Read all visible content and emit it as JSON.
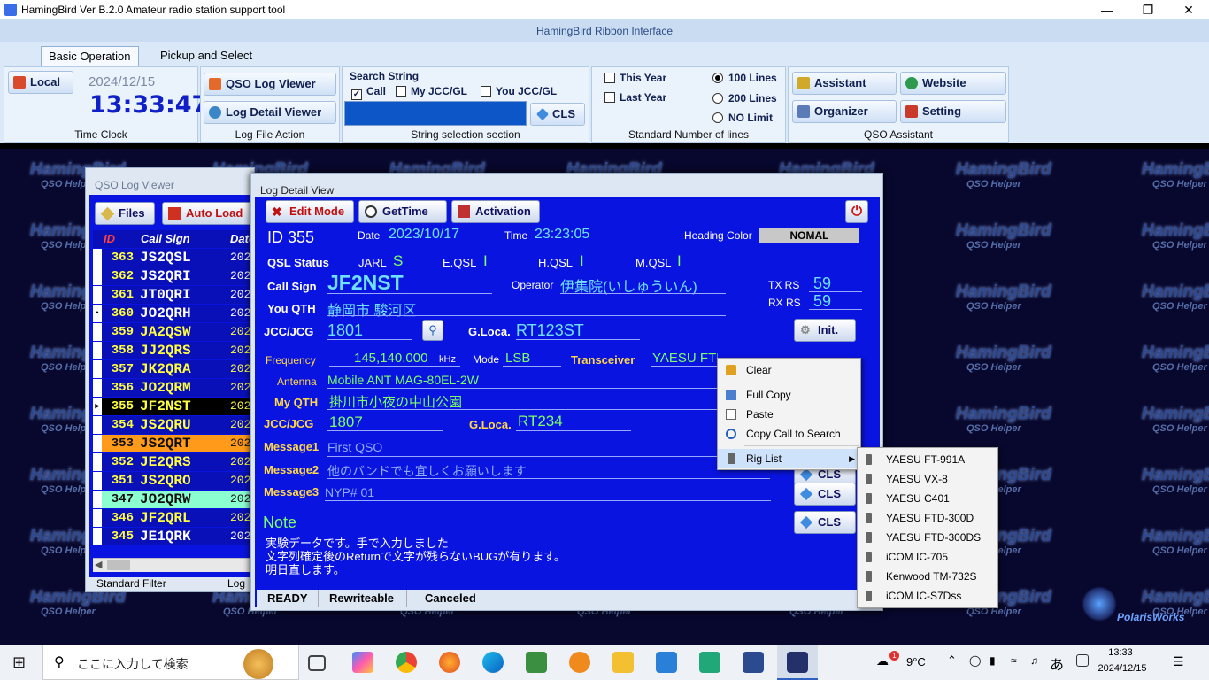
{
  "window": {
    "title": "HamingBird Ver B.2.0   Amateur radio station support tool"
  },
  "ribbon": {
    "header": "HamingBird Ribbon Interface",
    "tabs": [
      "Basic Operation",
      "Pickup and Select"
    ],
    "time_clock": {
      "local_label": "Local",
      "date": "2024/12/15",
      "time": "13:33:47",
      "group_label": "Time Clock"
    },
    "log_file_action": {
      "qso_log_viewer": "QSO Log Viewer",
      "log_detail_viewer": "Log Detail Viewer",
      "group_label": "Log File Action"
    },
    "string_selection": {
      "search_label": "Search String",
      "call": "Call",
      "my_jcc": "My JCC/GL",
      "you_jcc": "You JCC/GL",
      "cls": "CLS",
      "group_label": "String selection section"
    },
    "lines": {
      "this_year": "This Year",
      "last_year": "Last Year",
      "opt100": "100 Lines",
      "opt200": "200 Lines",
      "optno": "NO Limit",
      "group_label": "Standard Number of lines"
    },
    "assistant": {
      "assistant": "Assistant",
      "website": "Website",
      "organizer": "Organizer",
      "setting": "Setting",
      "group_label": "QSO Assistant"
    }
  },
  "watermark": {
    "brand": "HamingBird",
    "sub": "QSO Helper",
    "corner": "PolarisWorks"
  },
  "qso_viewer": {
    "title": "QSO Log Viewer",
    "files": "Files",
    "auto_load": "Auto Load",
    "col_id": "ID",
    "col_call": "Call Sign",
    "col_date": "Date",
    "footer_left": "Standard Filter",
    "footer_right": "Log",
    "rows": [
      {
        "id": "363",
        "call": "JS2QSL",
        "date": "202",
        "bg": "#0a10b8",
        "fg": "#ffffff",
        "idbg": "#0a10b8",
        "idfg": "#ffff40"
      },
      {
        "id": "362",
        "call": "JS2QRI",
        "date": "202",
        "bg": "#0a10b8",
        "fg": "#ffffff",
        "idbg": "#0a10b8",
        "idfg": "#ffff40"
      },
      {
        "id": "361",
        "call": "JT0QRI",
        "date": "202",
        "bg": "#0a10b8",
        "fg": "#ffffff",
        "idbg": "#0a10b8",
        "idfg": "#ffff40"
      },
      {
        "id": "360",
        "call": "JO2QRH",
        "date": "202",
        "bg": "#0a10b8",
        "fg": "#ffffff",
        "idbg": "#0a10b8",
        "idfg": "#ffff40"
      },
      {
        "id": "359",
        "call": "JA2QSW",
        "date": "202",
        "bg": "#0a10b8",
        "fg": "#ffff40",
        "idbg": "#0a10b8",
        "idfg": "#ffff40"
      },
      {
        "id": "358",
        "call": "JJ2QRS",
        "date": "202",
        "bg": "#0a10b8",
        "fg": "#ffff40",
        "idbg": "#0a10b8",
        "idfg": "#ffff40"
      },
      {
        "id": "357",
        "call": "JK2QRA",
        "date": "202",
        "bg": "#0a10b8",
        "fg": "#ffff40",
        "idbg": "#0a10b8",
        "idfg": "#ffff40"
      },
      {
        "id": "356",
        "call": "JO2QRM",
        "date": "202",
        "bg": "#0a10b8",
        "fg": "#ffff40",
        "idbg": "#0a10b8",
        "idfg": "#ffff40"
      },
      {
        "id": "355",
        "call": "JF2NST",
        "date": "202",
        "bg": "#000000",
        "fg": "#ffff40",
        "idbg": "#000000",
        "idfg": "#ffff40"
      },
      {
        "id": "354",
        "call": "JS2QRU",
        "date": "202",
        "bg": "#0a10b8",
        "fg": "#ffff40",
        "idbg": "#0a10b8",
        "idfg": "#ffff40"
      },
      {
        "id": "353",
        "call": "JS2QRT",
        "date": "202",
        "bg": "#ff9a1a",
        "fg": "#101010",
        "idbg": "#ff9a1a",
        "idfg": "#101010"
      },
      {
        "id": "352",
        "call": "JE2QRS",
        "date": "202",
        "bg": "#0a10b8",
        "fg": "#ffff40",
        "idbg": "#0a10b8",
        "idfg": "#ffff40"
      },
      {
        "id": "351",
        "call": "JS2QRO",
        "date": "202",
        "bg": "#0a10b8",
        "fg": "#ffff40",
        "idbg": "#0a10b8",
        "idfg": "#ffff40"
      },
      {
        "id": "347",
        "call": "JO2QRW",
        "date": "202",
        "bg": "#8cffd0",
        "fg": "#101010",
        "idbg": "#8cffd0",
        "idfg": "#101010"
      },
      {
        "id": "346",
        "call": "JF2QRL",
        "date": "202",
        "bg": "#0a10b8",
        "fg": "#ffff40",
        "idbg": "#0a10b8",
        "idfg": "#ffff40"
      },
      {
        "id": "345",
        "call": "JE1QRK",
        "date": "202",
        "bg": "#0a10b8",
        "fg": "#ffffff",
        "idbg": "#0a10b8",
        "idfg": "#ffff40"
      }
    ]
  },
  "log_detail": {
    "title": "Log Detail View",
    "edit_mode": "Edit Mode",
    "get_time": "GetTime",
    "activation": "Activation",
    "id": "ID 355",
    "date_label": "Date",
    "date": "2023/10/17",
    "time_label": "Time",
    "time": "23:23:05",
    "heading_color_label": "Heading Color",
    "heading_color": "NOMAL",
    "qsl_status": "QSL Status",
    "jarl_label": "JARL",
    "jarl": "S",
    "eqsl_label": "E.QSL",
    "eqsl": "I",
    "hqsl_label": "H.QSL",
    "hqsl": "I",
    "mqsl_label": "M.QSL",
    "mqsl": "I",
    "call_sign_label": "Call Sign",
    "call_sign": "JF2NST",
    "operator_label": "Operator",
    "operator": "伊集院(いしゅういん)",
    "tx_rs_label": "TX RS",
    "tx_rs": "59",
    "rx_rs_label": "RX RS",
    "rx_rs": "59",
    "you_qth_label": "You QTH",
    "you_qth": "静岡市 駿河区",
    "jcc_label": "JCC/JCG",
    "jcc": "1801",
    "gloca_label": "G.Loca.",
    "gloca": "RT123ST",
    "init": "Init.",
    "frequency_label": "Frequency",
    "frequency": "145,140.000",
    "khz": "kHz",
    "mode_label": "Mode",
    "mode": "LSB",
    "transceiver_label": "Transceiver",
    "transceiver": "YAESU FTD-300D",
    "antenna_label": "Antenna",
    "antenna": "Mobile ANT MAG-80EL-2W",
    "my_qth_label": "My QTH",
    "my_qth": "掛川市小夜の中山公園",
    "my_jcc_label": "JCC/JCG",
    "my_jcc": "1807",
    "my_gloca_label": "G.Loca.",
    "my_gloca": "RT234",
    "message1_label": "Message1",
    "message1": "First QSO",
    "message2_label": "Message2",
    "message2": "他のバンドでも宜しくお願いします",
    "message3_label": "Message3",
    "message3": "NYP# 01",
    "note_label": "Note",
    "note_lines": [
      "実験データです。手で入力しました",
      "文字列確定後のReturnで文字が残らないBUGが有ります。",
      "明日直します。"
    ],
    "cls1": "CLS",
    "cls2": "CLS",
    "cls3": "CLS",
    "status": [
      "READY",
      "Rewriteable",
      "Canceled"
    ]
  },
  "context_menu": {
    "items": [
      "Clear",
      "Full Copy",
      "Paste",
      "Copy Call to Search",
      "Rig List"
    ]
  },
  "rig_list": [
    "YAESU FT-991A",
    "YAESU VX-8",
    "YAESU C401",
    "YAESU FTD-300D",
    "YAESU FTD-300DS",
    "iCOM IC-705",
    "Kenwood TM-732S",
    "iCOM IC-S7Dss"
  ],
  "taskbar": {
    "search_placeholder": "ここに入力して検索",
    "weather": "9°C",
    "ime": "あ",
    "clock_time": "13:33",
    "clock_date": "2024/12/15",
    "notif_badge": "1"
  }
}
